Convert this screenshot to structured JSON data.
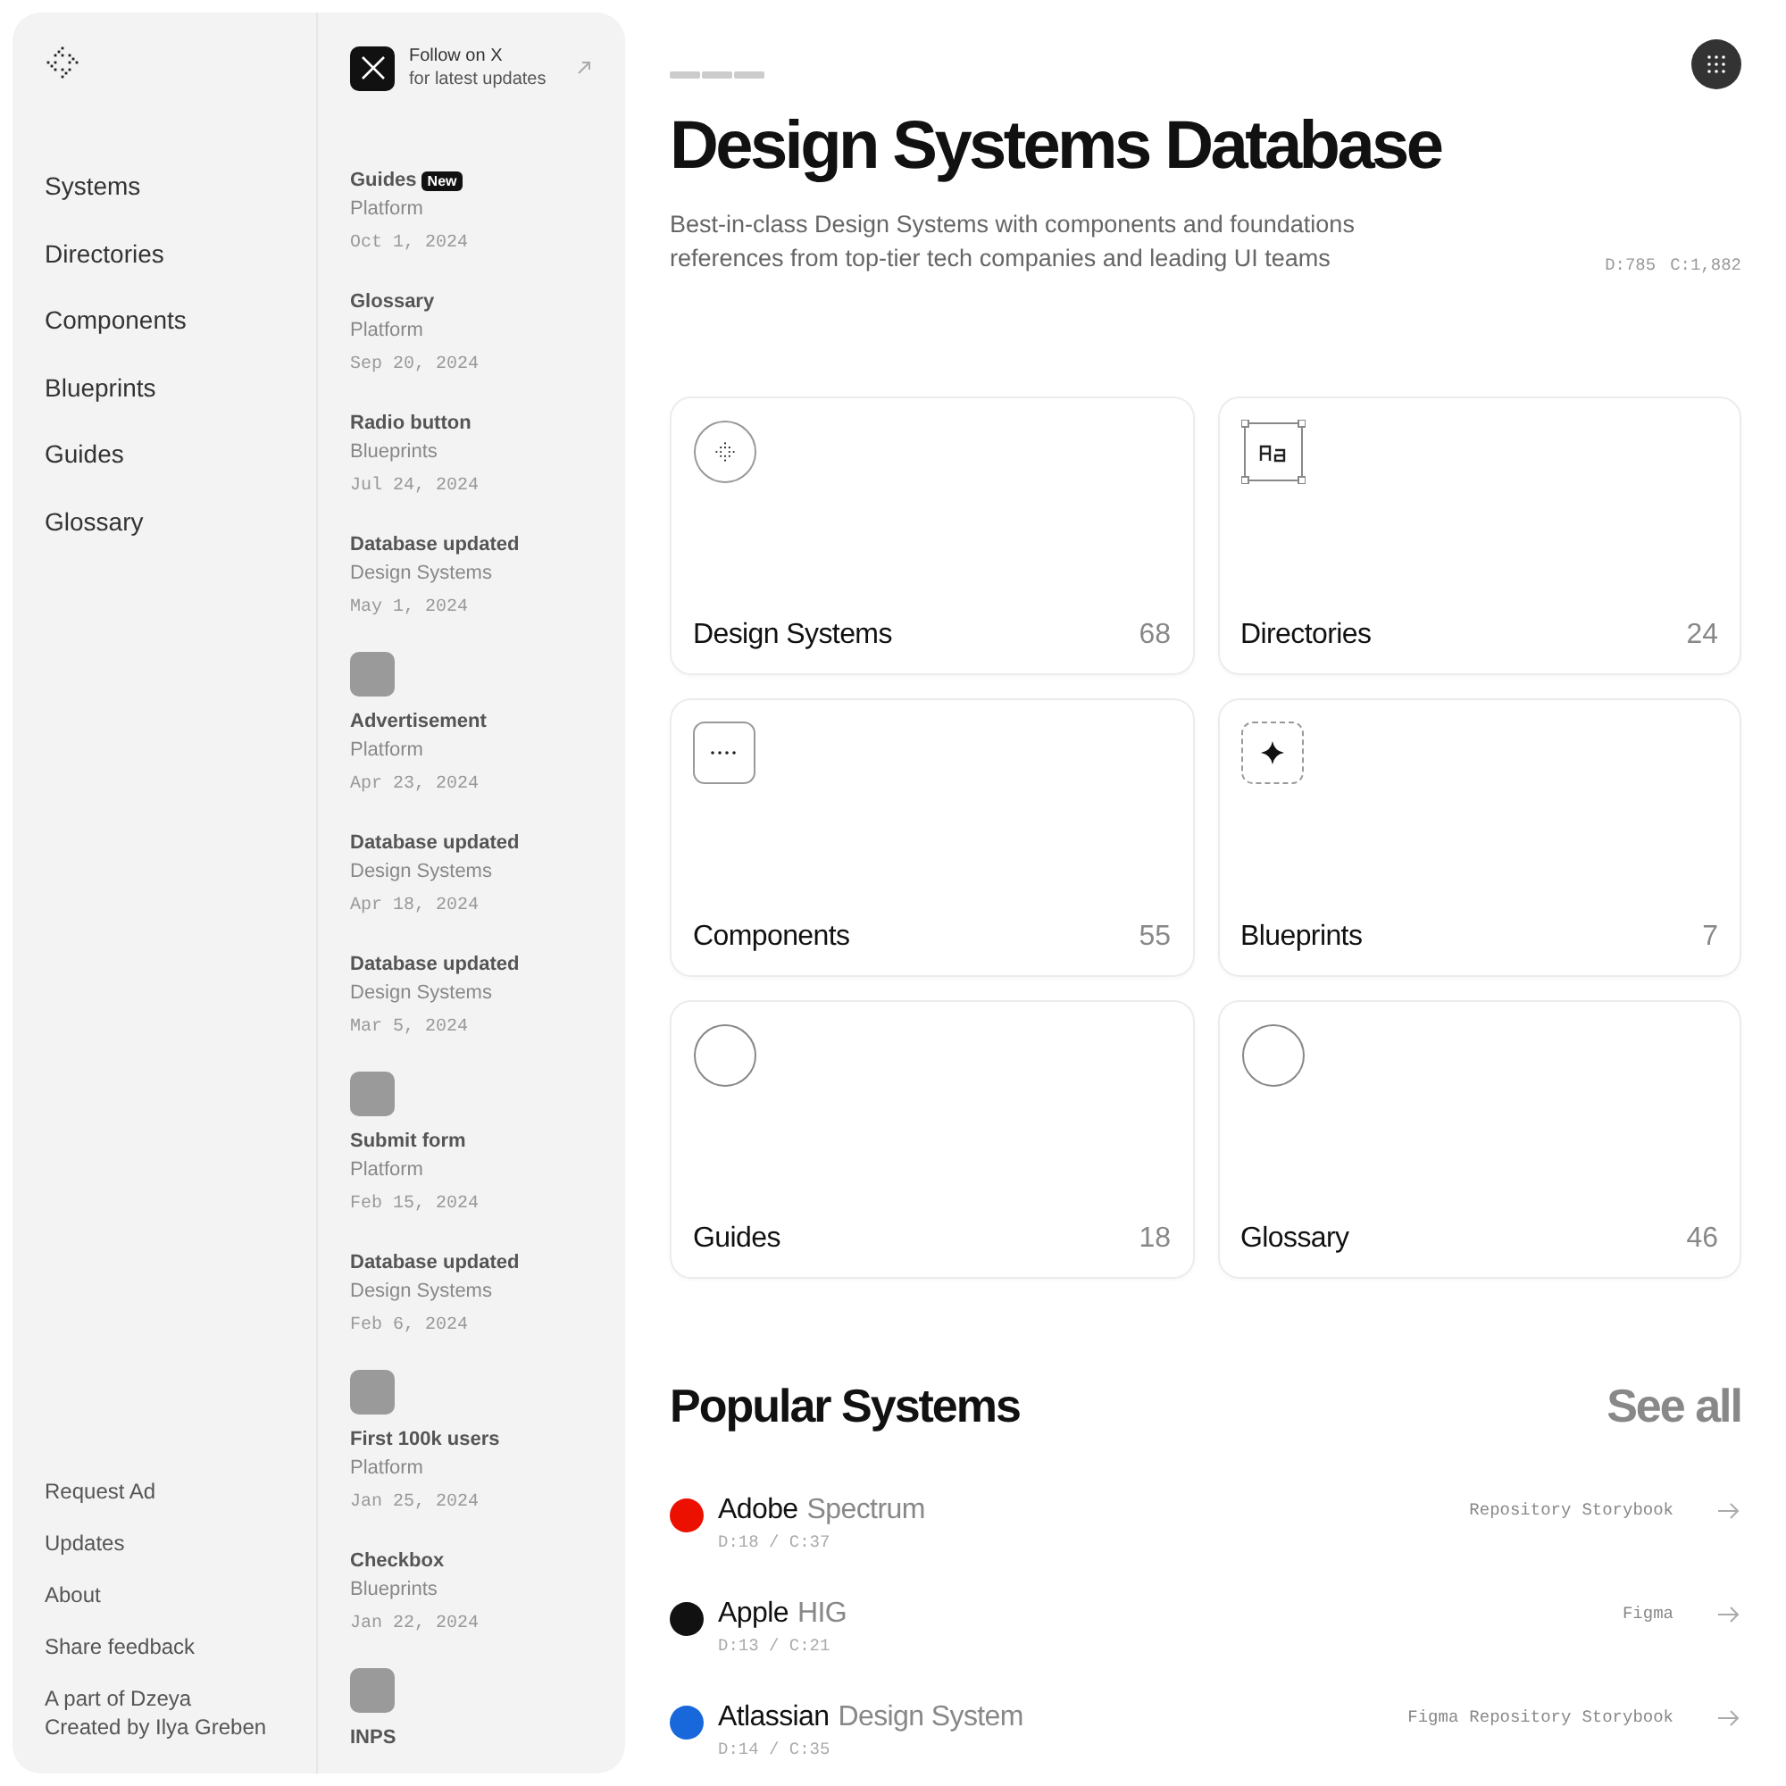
{
  "sidebar": {
    "nav": [
      {
        "label": "Systems"
      },
      {
        "label": "Directories"
      },
      {
        "label": "Components"
      },
      {
        "label": "Blueprints"
      },
      {
        "label": "Guides"
      },
      {
        "label": "Glossary"
      }
    ],
    "footer_links": [
      {
        "label": "Request Ad"
      },
      {
        "label": "Updates"
      },
      {
        "label": "About"
      },
      {
        "label": "Share feedback"
      }
    ],
    "credits": [
      "A part of Dzeya",
      "Created by Ilya Greben"
    ]
  },
  "updates": {
    "follow": {
      "title": "Follow on X",
      "subtitle": "for latest updates"
    },
    "items": [
      {
        "kind": "text",
        "title": "Guides",
        "badge": "New",
        "category": "Platform",
        "date": "Oct 1, 2024"
      },
      {
        "kind": "text",
        "title": "Glossary",
        "category": "Platform",
        "date": "Sep 20, 2024"
      },
      {
        "kind": "text",
        "title": "Radio button",
        "category": "Blueprints",
        "date": "Jul 24, 2024"
      },
      {
        "kind": "text",
        "title": "Database updated",
        "category": "Design Systems",
        "date": "May 1, 2024"
      },
      {
        "kind": "image",
        "title": "Advertisement",
        "category": "Platform",
        "date": "Apr 23, 2024"
      },
      {
        "kind": "text",
        "title": "Database updated",
        "category": "Design Systems",
        "date": "Apr 18, 2024"
      },
      {
        "kind": "text",
        "title": "Database updated",
        "category": "Design Systems",
        "date": "Mar 5, 2024"
      },
      {
        "kind": "image",
        "title": "Submit form",
        "category": "Platform",
        "date": "Feb 15, 2024"
      },
      {
        "kind": "text",
        "title": "Database updated",
        "category": "Design Systems",
        "date": "Feb 6, 2024"
      },
      {
        "kind": "image",
        "title": "First 100k users",
        "category": "Platform",
        "date": "Jan 25, 2024"
      },
      {
        "kind": "text",
        "title": "Checkbox",
        "category": "Blueprints",
        "date": "Jan 22, 2024"
      },
      {
        "kind": "image",
        "title": "INPS"
      }
    ]
  },
  "header": {
    "title": "Design Systems Database",
    "description": "Best-in-class Design Systems with components and foundations references from top-tier tech companies and leading UI teams",
    "stats": [
      "D:785",
      "C:1,882"
    ]
  },
  "categories": [
    {
      "kind": "sparkle",
      "label": "Design Systems",
      "count": "68"
    },
    {
      "kind": "type",
      "label": "Directories",
      "count": "24"
    },
    {
      "kind": "dots",
      "label": "Components",
      "count": "55"
    },
    {
      "kind": "star",
      "label": "Blueprints",
      "count": "7"
    },
    {
      "kind": "circle",
      "label": "Guides",
      "count": "18"
    },
    {
      "kind": "circle",
      "label": "Glossary",
      "count": "46"
    }
  ],
  "popular": {
    "title": "Popular Systems",
    "see_all": "See all",
    "systems": [
      {
        "company": "Adobe",
        "product": "Spectrum",
        "stats": "D:18 / C:37",
        "color": "#eb1000",
        "links": [
          "Repository",
          "Storybook"
        ]
      },
      {
        "company": "Apple",
        "product": "HIG",
        "stats": "D:13 / C:21",
        "color": "#111111",
        "links": [
          "Figma"
        ]
      },
      {
        "company": "Atlassian",
        "product": "Design System",
        "stats": "D:14 / C:35",
        "color": "#1868db",
        "links": [
          "Figma",
          "Repository",
          "Storybook"
        ]
      }
    ]
  }
}
